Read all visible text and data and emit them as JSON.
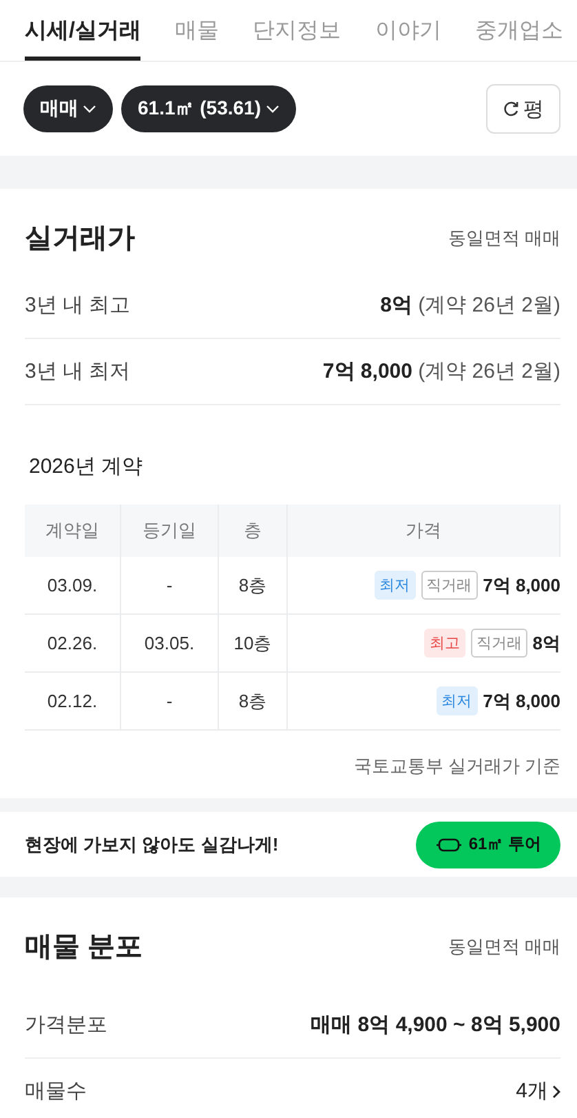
{
  "tabs": [
    {
      "label": "시세/실거래",
      "selected": true
    },
    {
      "label": "매물",
      "selected": false
    },
    {
      "label": "단지정보",
      "selected": false
    },
    {
      "label": "이야기",
      "selected": false
    },
    {
      "label": "중개업소",
      "selected": false
    }
  ],
  "filters": [
    {
      "label": "매매"
    },
    {
      "label": "61.1㎡ (53.61)"
    }
  ],
  "unit_button": {
    "label": "평"
  },
  "trade_price": {
    "title": "실거래가",
    "subtitle": "동일면적 매매",
    "summary": [
      {
        "label": "3년 내 최고",
        "value": "8억",
        "note": "(계약 26년 2월)"
      },
      {
        "label": "3년 내 최저",
        "value": "7억 8,000",
        "note": "(계약 26년 2월)"
      }
    ],
    "year_title": "2026년 계약",
    "table": {
      "columns": [
        "계약일",
        "등기일",
        "층",
        "가격"
      ],
      "rows": [
        {
          "contract": "03.09.",
          "registered": "-",
          "floor": "8층",
          "tags": [
            {
              "kind": "lowest",
              "label": "최저"
            },
            {
              "kind": "direct",
              "label": "직거래"
            }
          ],
          "price": "7억 8,000"
        },
        {
          "contract": "02.26.",
          "registered": "03.05.",
          "floor": "10층",
          "tags": [
            {
              "kind": "highest",
              "label": "최고"
            },
            {
              "kind": "direct",
              "label": "직거래"
            }
          ],
          "price": "8억"
        },
        {
          "contract": "02.12.",
          "registered": "-",
          "floor": "8층",
          "tags": [
            {
              "kind": "lowest",
              "label": "최저"
            }
          ],
          "price": "7억 8,000"
        }
      ]
    },
    "source": "국토교통부 실거래가 기준"
  },
  "tour_banner": {
    "text": "현장에 가보지 않아도 실감나게!",
    "button": "61㎡ 투어"
  },
  "listing_distribution": {
    "title": "매물 분포",
    "subtitle": "동일면적 매매",
    "rows": [
      {
        "label": "가격분포",
        "value": "매매 8억 4,900 ~ 8억 5,900",
        "link": false
      },
      {
        "label": "매물수",
        "value": "4개",
        "link": true
      }
    ]
  }
}
